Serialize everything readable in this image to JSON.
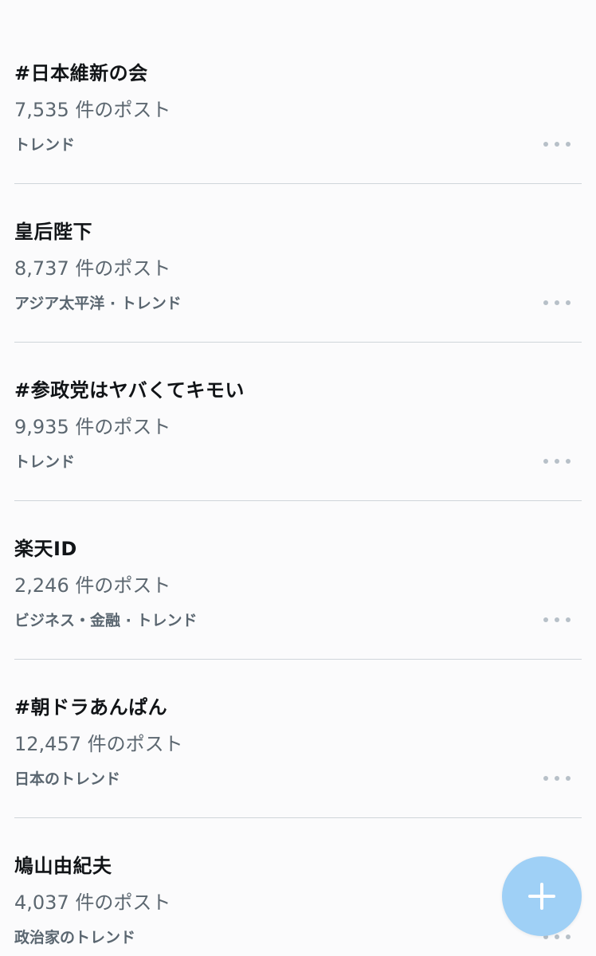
{
  "trends": [
    {
      "title": "#日本維新の会",
      "count": "7,535 件のポスト",
      "category": "トレンド"
    },
    {
      "title": "皇后陛下",
      "count": "8,737 件のポスト",
      "category": "アジア太平洋 · トレンド"
    },
    {
      "title": "#参政党はヤバくてキモい",
      "count": "9,935 件のポスト",
      "category": "トレンド"
    },
    {
      "title": "楽天ID",
      "count": "2,246 件のポスト",
      "category": "ビジネス・金融 · トレンド"
    },
    {
      "title": "#朝ドラあんぱん",
      "count": "12,457 件のポスト",
      "category": "日本のトレンド"
    },
    {
      "title": "鳩山由紀夫",
      "count": "4,037 件のポスト",
      "category": "政治家のトレンド"
    }
  ],
  "icons": {
    "more": "more-horizontal-icon",
    "compose": "plus-icon"
  },
  "colors": {
    "fab": "#9fd0f6",
    "primary_text": "#111417",
    "secondary_text": "#5c6770",
    "divider": "#cfd5da"
  }
}
